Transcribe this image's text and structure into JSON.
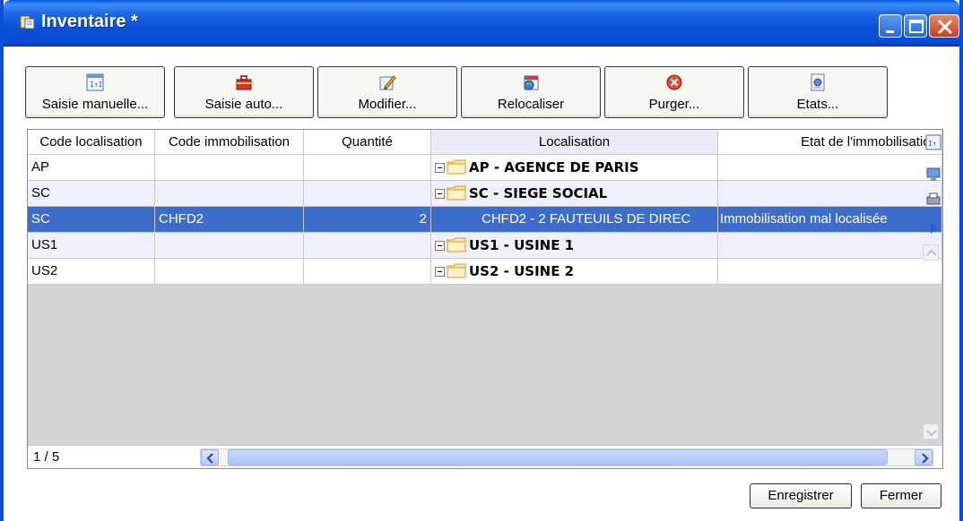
{
  "window": {
    "title": "Inventaire *"
  },
  "toolbar": {
    "buttons": [
      {
        "label": "Saisie manuelle...",
        "icon": "manual-entry-icon"
      },
      {
        "label": "Saisie auto...",
        "icon": "toolbox-icon"
      },
      {
        "label": "Modifier...",
        "icon": "edit-pencil-icon"
      },
      {
        "label": "Relocaliser",
        "icon": "calendar-globe-icon"
      },
      {
        "label": "Purger...",
        "icon": "red-x-icon"
      },
      {
        "label": "Etats...",
        "icon": "report-icon"
      }
    ]
  },
  "grid": {
    "columns": [
      "Code localisation",
      "Code immobilisation",
      "Quantité",
      "Localisation",
      "Etat de l'immobilisation"
    ],
    "rows": [
      {
        "code_loc": "AP",
        "code_immo": "",
        "quantite": "",
        "localisation": "AP - AGENCE DE PARIS",
        "etat": "",
        "type": "group"
      },
      {
        "code_loc": "SC",
        "code_immo": "",
        "quantite": "",
        "localisation": "SC - SIEGE SOCIAL",
        "etat": "",
        "type": "group"
      },
      {
        "code_loc": "SC",
        "code_immo": "CHFD2",
        "quantite": "2",
        "localisation": "CHFD2 - 2 FAUTEUILS DE DIREC",
        "etat": "Immobilisation mal localisée",
        "type": "item",
        "selected": true
      },
      {
        "code_loc": "US1",
        "code_immo": "",
        "quantite": "",
        "localisation": "US1 - USINE 1",
        "etat": "",
        "type": "group"
      },
      {
        "code_loc": "US2",
        "code_immo": "",
        "quantite": "",
        "localisation": "US2 - USINE 2",
        "etat": "",
        "type": "group"
      }
    ],
    "pager": "1 / 5"
  },
  "footer": {
    "save_label": "Enregistrer",
    "close_label": "Fermer"
  },
  "colors": {
    "titlebar": "#0b4fd6",
    "selection": "#3d6ccd",
    "alt_row": "#eef0fb"
  }
}
